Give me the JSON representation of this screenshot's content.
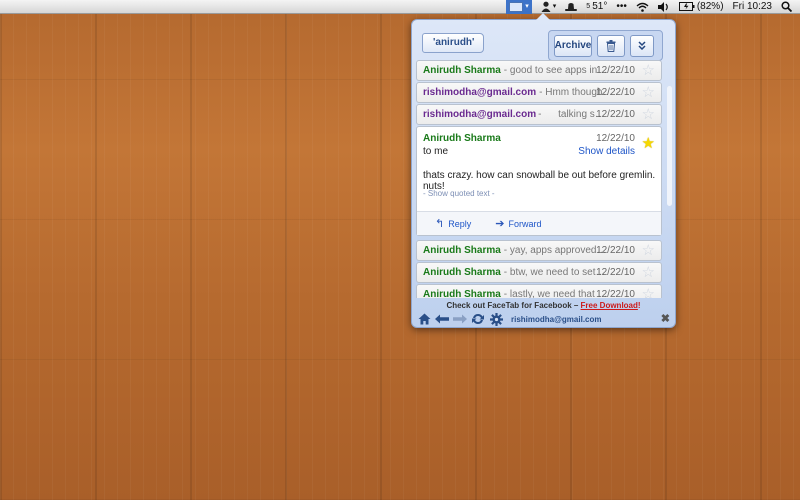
{
  "menubar": {
    "weather_temp": "51°",
    "weather_small": "5",
    "battery": "(82%)",
    "clock": "Fri 10:23",
    "icons": [
      "mail-icon",
      "user-icon",
      "hat-icon",
      "temperature-icon",
      "dots-icon",
      "wifi-icon",
      "volume-icon",
      "battery-icon",
      "spotlight-icon"
    ]
  },
  "popup": {
    "back_label": "'anirudh'",
    "toolbar": {
      "archive_label": "Archive",
      "trash_icon": "trash-icon",
      "more_icon": "double-chevron-down-icon"
    },
    "threads_top": [
      {
        "sender": "Anirudh Sharma",
        "snippet": " - good to see apps in re...",
        "date": "12/22/10",
        "starred": false
      },
      {
        "sender": "rishimodha@gmail.com",
        "snippet": " - Hmm thought ...",
        "date": "12/22/10",
        "starred": false
      },
      {
        "sender": "rishimodha@gmail.com",
        "snippet": " -",
        "snippet2": "talking sn...",
        "date": "12/22/10",
        "starred": false
      }
    ],
    "open_message": {
      "sender": "Anirudh Sharma",
      "date": "12/22/10",
      "to": "to me",
      "show_details": "Show details",
      "body": "thats crazy. how can snowball be out before gremlin. nuts!",
      "show_quoted": "- Show quoted text -",
      "reply_label": "Reply",
      "forward_label": "Forward",
      "starred": true
    },
    "threads_bottom": [
      {
        "sender": "Anirudh Sharma",
        "snippet": " - yay, apps approved :) l...",
        "date": "12/22/10",
        "starred": false
      },
      {
        "sender": "Anirudh Sharma",
        "snippet": " - btw, we need to setup ...",
        "date": "12/22/10",
        "starred": false
      },
      {
        "sender": "Anirudh Sharma",
        "snippet": " - lastly, we need that to...",
        "date": "12/22/10",
        "starred": false
      }
    ],
    "promo_text": "Check out FaceTab for Facebook – ",
    "promo_link": "Free Download",
    "promo_end": "!",
    "footer": {
      "account": "rishimodha@gmail.com",
      "icons": [
        "home-icon",
        "back-arrow-icon",
        "forward-arrow-icon",
        "refresh-icon",
        "settings-gear-icon",
        "close-icon"
      ]
    }
  }
}
